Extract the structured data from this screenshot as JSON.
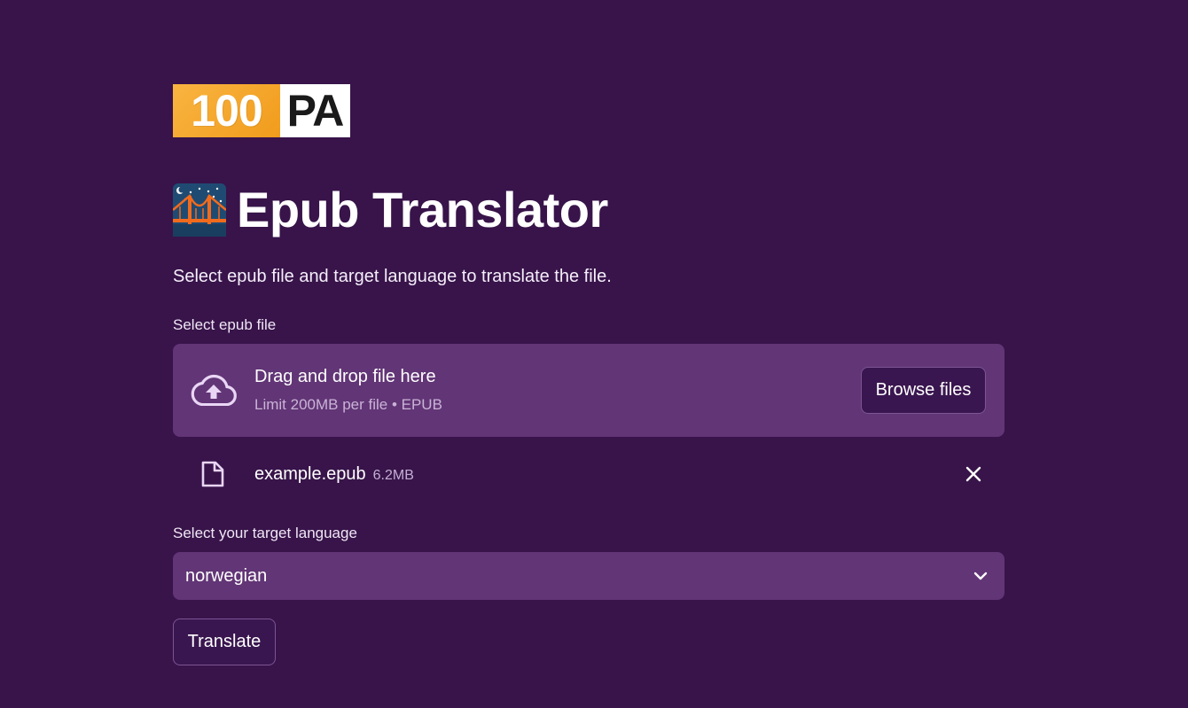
{
  "logo": {
    "left_text": "100",
    "right_text": "PA"
  },
  "header": {
    "title": "Epub Translator",
    "emoji_icon": "bridge-at-night-icon",
    "subtitle": "Select epub file and target language to translate the file."
  },
  "file_upload": {
    "label": "Select epub file",
    "drag_text": "Drag and drop file here",
    "limit_text": "Limit 200MB per file • EPUB",
    "browse_label": "Browse files",
    "icon": "cloud-upload-icon"
  },
  "uploaded_file": {
    "name": "example.epub",
    "size": "6.2MB",
    "icon": "file-icon",
    "remove_icon": "close-icon"
  },
  "language": {
    "label": "Select your target language",
    "selected": "norwegian",
    "icon": "chevron-down-icon"
  },
  "actions": {
    "translate_label": "Translate"
  },
  "colors": {
    "background": "#38144a",
    "panel": "#623576",
    "button_bg": "#3a1650",
    "button_border": "#7c5592",
    "logo_orange": "#f3a42a"
  }
}
